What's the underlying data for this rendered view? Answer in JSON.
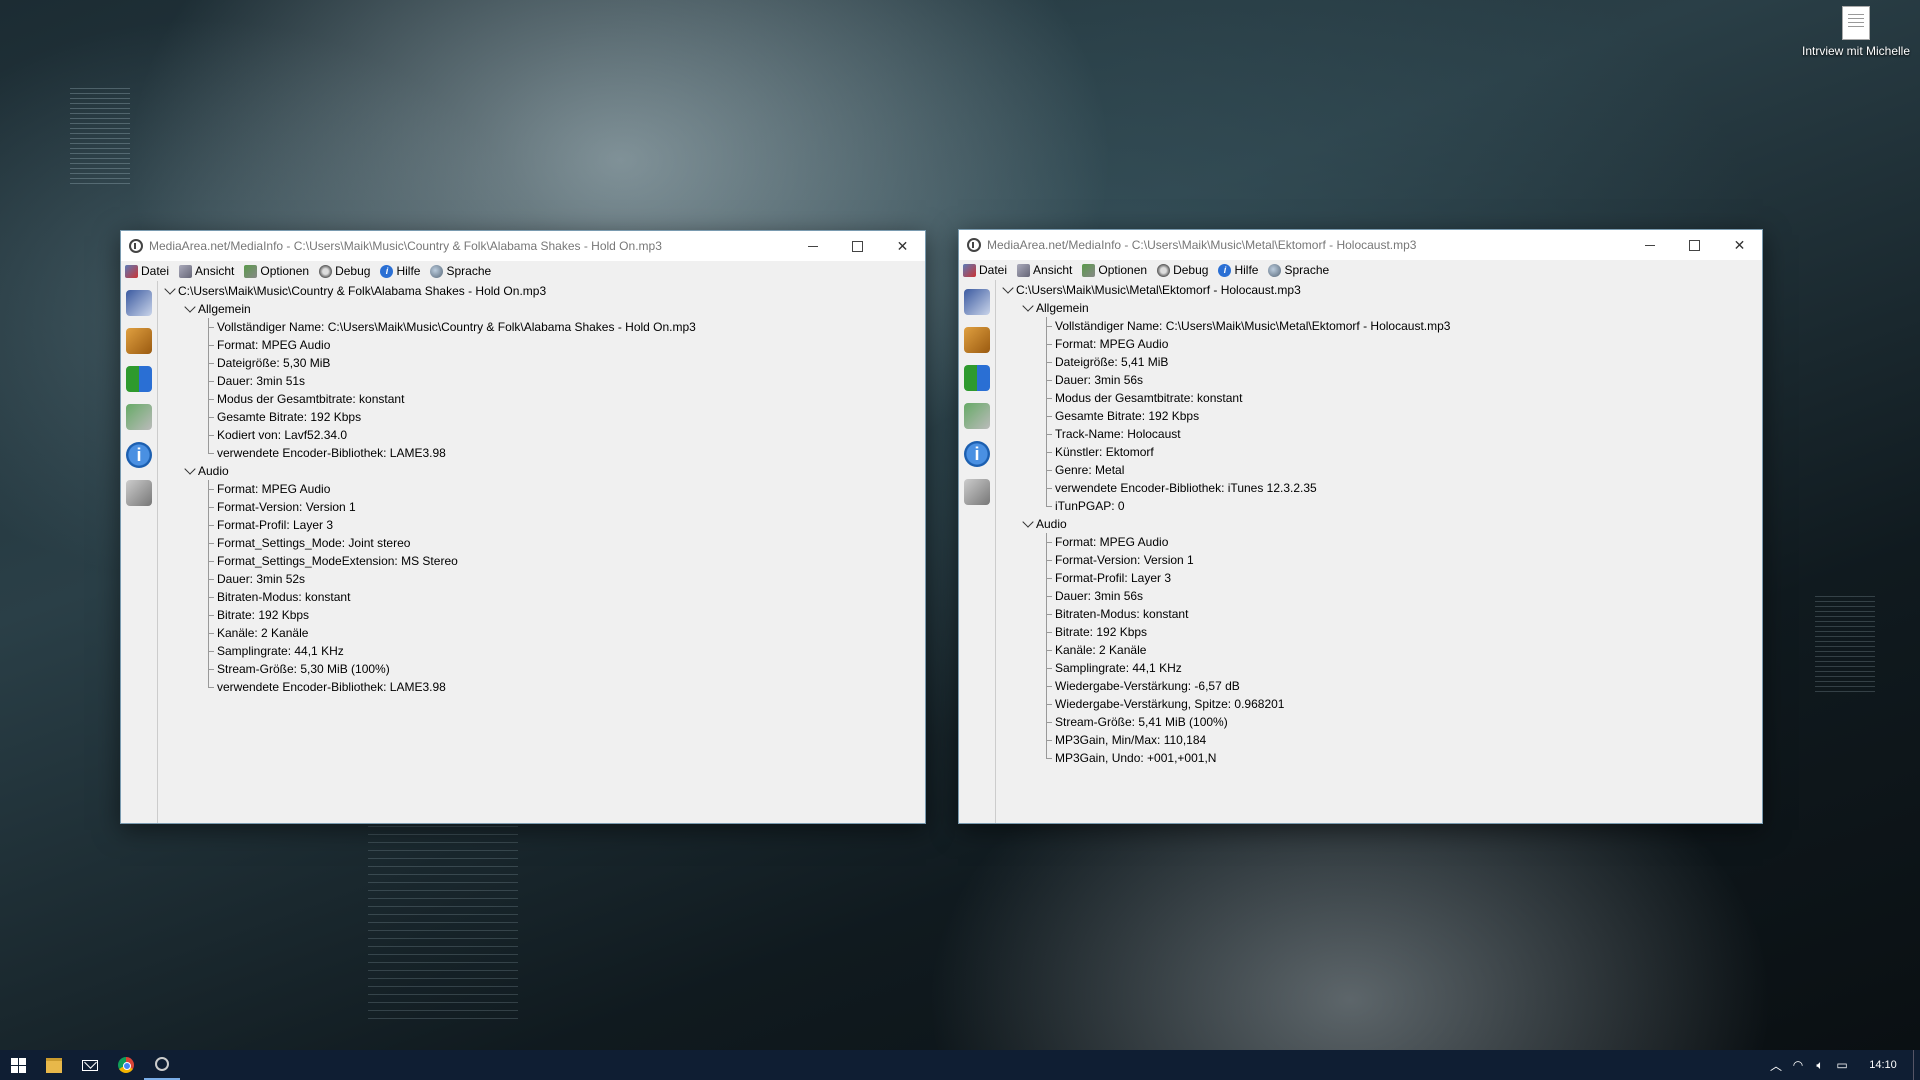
{
  "desktop": {
    "icon_label": "Intrview mit Michelle"
  },
  "menu": [
    "Datei",
    "Ansicht",
    "Optionen",
    "Debug",
    "Hilfe",
    "Sprache"
  ],
  "window1": {
    "title": "MediaArea.net/MediaInfo - C:\\Users\\Maik\\Music\\Country & Folk\\Alabama Shakes - Hold On.mp3",
    "root": "C:\\Users\\Maik\\Music\\Country & Folk\\Alabama Shakes - Hold On.mp3",
    "sections": [
      {
        "name": "Allgemein",
        "items": [
          "Vollständiger Name: C:\\Users\\Maik\\Music\\Country & Folk\\Alabama Shakes - Hold On.mp3",
          "Format: MPEG Audio",
          "Dateigröße: 5,30 MiB",
          "Dauer: 3min 51s",
          "Modus der Gesamtbitrate: konstant",
          "Gesamte Bitrate: 192 Kbps",
          "Kodiert von: Lavf52.34.0",
          "verwendete Encoder-Bibliothek: LAME3.98"
        ]
      },
      {
        "name": "Audio",
        "items": [
          "Format: MPEG Audio",
          "Format-Version: Version 1",
          "Format-Profil: Layer 3",
          "Format_Settings_Mode: Joint stereo",
          "Format_Settings_ModeExtension: MS Stereo",
          "Dauer: 3min 52s",
          "Bitraten-Modus: konstant",
          "Bitrate: 192 Kbps",
          "Kanäle: 2 Kanäle",
          "Samplingrate: 44,1 KHz",
          "Stream-Größe: 5,30 MiB (100%)",
          "verwendete Encoder-Bibliothek: LAME3.98"
        ]
      }
    ]
  },
  "window2": {
    "title": "MediaArea.net/MediaInfo - C:\\Users\\Maik\\Music\\Metal\\Ektomorf - Holocaust.mp3",
    "root": "C:\\Users\\Maik\\Music\\Metal\\Ektomorf - Holocaust.mp3",
    "sections": [
      {
        "name": "Allgemein",
        "items": [
          "Vollständiger Name: C:\\Users\\Maik\\Music\\Metal\\Ektomorf - Holocaust.mp3",
          "Format: MPEG Audio",
          "Dateigröße: 5,41 MiB",
          "Dauer: 3min 56s",
          "Modus der Gesamtbitrate: konstant",
          "Gesamte Bitrate: 192 Kbps",
          "Track-Name: Holocaust",
          "Künstler: Ektomorf",
          "Genre: Metal",
          "verwendete Encoder-Bibliothek: iTunes 12.3.2.35",
          "iTunPGAP: 0"
        ]
      },
      {
        "name": "Audio",
        "items": [
          "Format: MPEG Audio",
          "Format-Version: Version 1",
          "Format-Profil: Layer 3",
          "Dauer: 3min 56s",
          "Bitraten-Modus: konstant",
          "Bitrate: 192 Kbps",
          "Kanäle: 2 Kanäle",
          "Samplingrate: 44,1 KHz",
          "Wiedergabe-Verstärkung: -6,57 dB",
          "Wiedergabe-Verstärkung, Spitze: 0.968201",
          "Stream-Größe: 5,41 MiB (100%)",
          "MP3Gain, Min/Max: 110,184",
          "MP3Gain, Undo: +001,+001,N"
        ]
      }
    ]
  },
  "taskbar": {
    "clock": "14:10"
  }
}
